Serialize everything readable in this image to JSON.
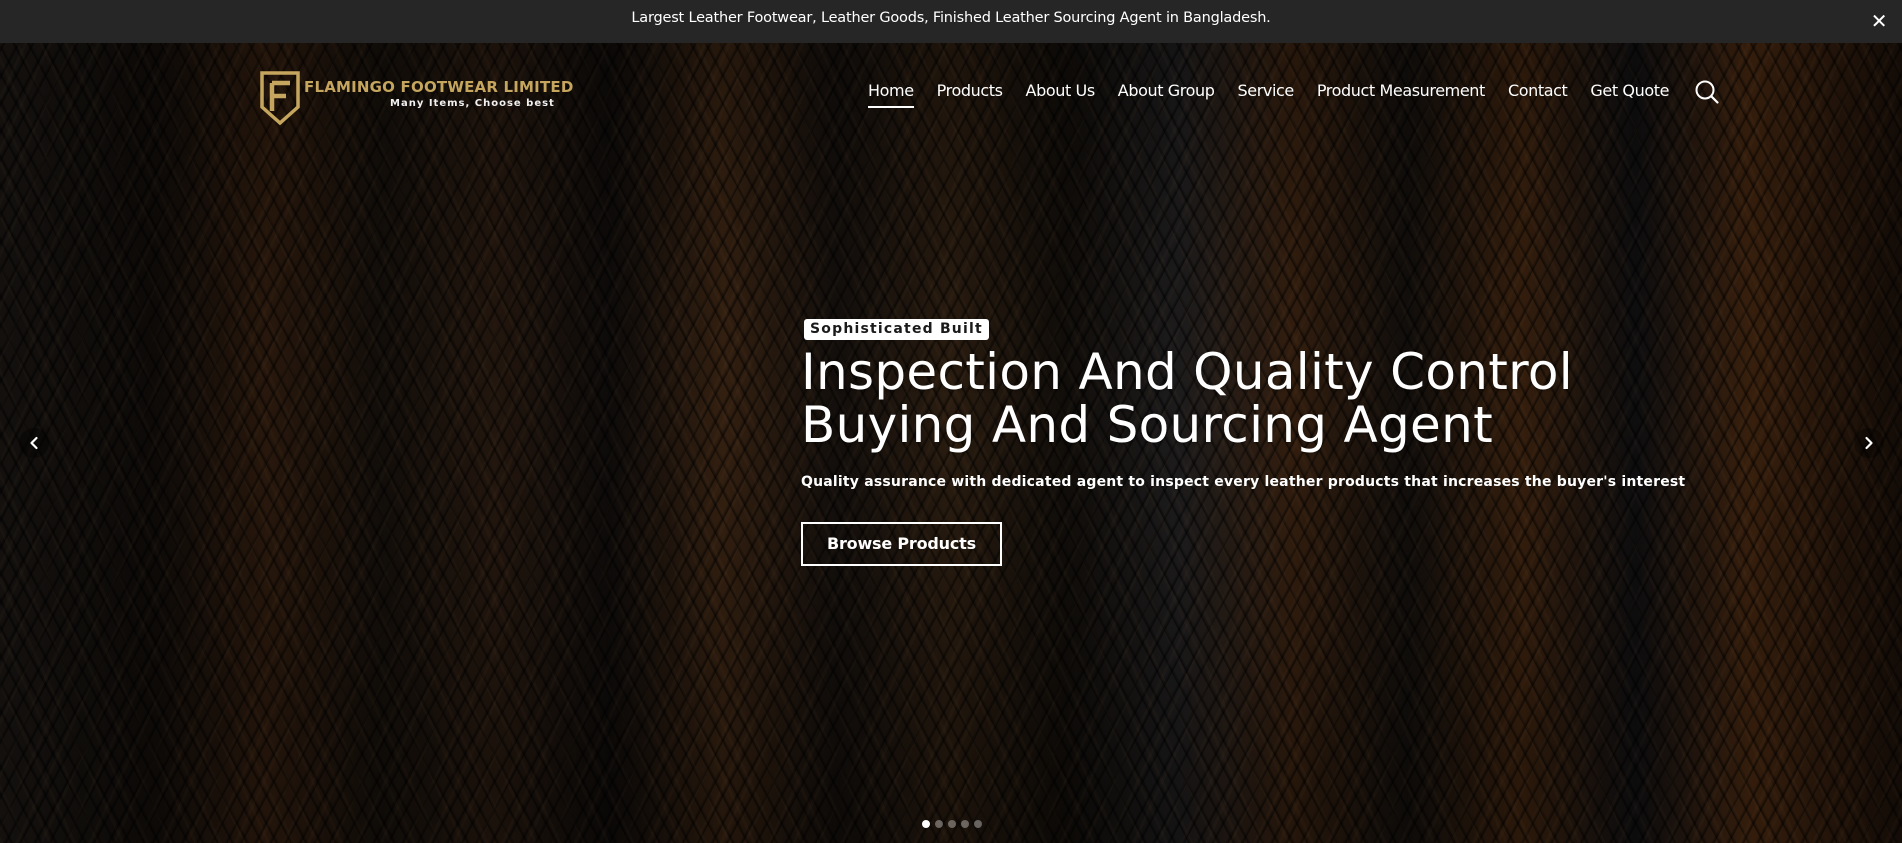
{
  "announcement": {
    "text": "Largest Leather Footwear, Leather Goods, Finished Leather Sourcing Agent in Bangladesh.",
    "close_icon": "close-icon",
    "close_glyph": "✕"
  },
  "brand": {
    "name": "FLAMINGO FOOTWEAR LIMITED",
    "tagline": "Many Items, Choose best",
    "logo_letter": "F",
    "logo_color": "#c6a65e"
  },
  "nav": {
    "items": [
      {
        "label": "Home",
        "active": true
      },
      {
        "label": "Products"
      },
      {
        "label": "About Us"
      },
      {
        "label": "About Group"
      },
      {
        "label": "Service"
      },
      {
        "label": "Product Measurement"
      },
      {
        "label": "Contact"
      },
      {
        "label": "Get Quote"
      }
    ],
    "search_icon": "search-icon"
  },
  "hero": {
    "badge": "Sophisticated Built",
    "headline_line1": "Inspection And Quality Control",
    "headline_line2": "Buying And Sourcing Agent",
    "subtitle": "Quality assurance with dedicated agent to inspect every leather products that increases the buyer's interest",
    "cta_label": "Browse Products",
    "prev_icon": "chevron-left-icon",
    "next_icon": "chevron-right-icon"
  },
  "slider": {
    "slide_count": 5,
    "active_index": 0
  },
  "colors": {
    "topbar_bg": "#262626",
    "accent_gold": "#c6a65e",
    "text": "#ffffff"
  }
}
